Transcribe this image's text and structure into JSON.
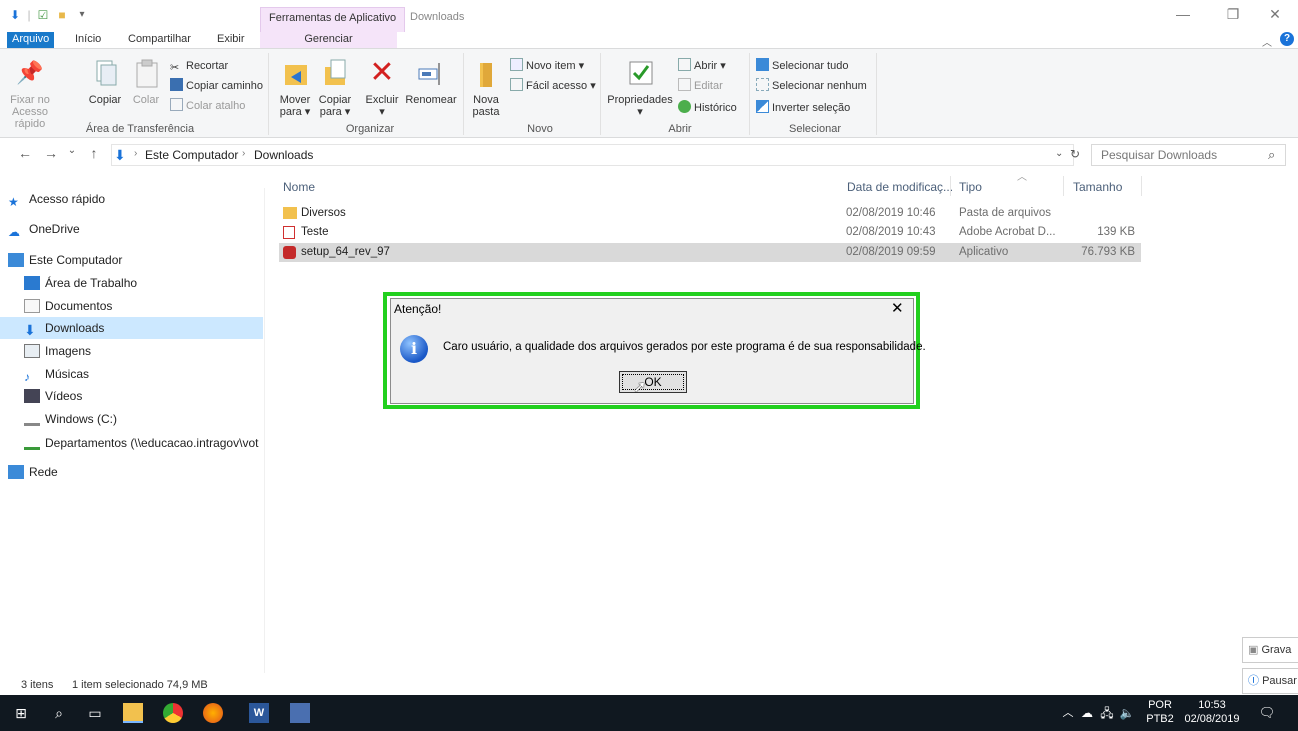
{
  "titlebar": {
    "tool_tab": "Ferramentas de Aplicativo",
    "window_title": "Downloads"
  },
  "ribbon_tabs": {
    "arquivo": "Arquivo",
    "inicio": "Início",
    "compartilhar": "Compartilhar",
    "exibir": "Exibir",
    "gerenciar": "Gerenciar"
  },
  "ribbon": {
    "fixar_1": "Fixar no",
    "fixar_2": "Acesso rápido",
    "copiar": "Copiar",
    "colar": "Colar",
    "recortar": "Recortar",
    "copiar_caminho": "Copiar caminho",
    "colar_atalho": "Colar atalho",
    "group_transferencia": "Área de Transferência",
    "mover_1": "Mover",
    "mover_2": "para ▾",
    "copiar_para_1": "Copiar",
    "copiar_para_2": "para ▾",
    "excluir_1": "Excluir",
    "excluir_2": "▾",
    "renomear": "Renomear",
    "group_organizar": "Organizar",
    "nova_pasta_1": "Nova",
    "nova_pasta_2": "pasta",
    "novo_item": "Novo item ▾",
    "facil_acesso": "Fácil acesso ▾",
    "group_novo": "Novo",
    "propriedades_1": "Propriedades",
    "propriedades_2": "▾",
    "abrir": "Abrir ▾",
    "editar": "Editar",
    "historico": "Histórico",
    "group_abrir": "Abrir",
    "selecionar_tudo": "Selecionar tudo",
    "selecionar_nenhum": "Selecionar nenhum",
    "inverter_selecao": "Inverter seleção",
    "group_selecionar": "Selecionar"
  },
  "address": {
    "crumb_1": "Este Computador",
    "crumb_2": "Downloads",
    "search_placeholder": "Pesquisar Downloads"
  },
  "sidebar": {
    "items": [
      "Acesso rápido",
      "OneDrive",
      "Este Computador",
      "Área de Trabalho",
      "Documentos",
      "Downloads",
      "Imagens",
      "Músicas",
      "Vídeos",
      "Windows (C:)",
      "Departamentos (\\\\educacao.intragov\\vot",
      "Rede"
    ]
  },
  "columns": {
    "nome": "Nome",
    "data": "Data de modificaç...",
    "tipo": "Tipo",
    "tamanho": "Tamanho"
  },
  "files": [
    {
      "name": "Diversos",
      "date": "02/08/2019 10:46",
      "type": "Pasta de arquivos",
      "size": ""
    },
    {
      "name": "Teste",
      "date": "02/08/2019 10:43",
      "type": "Adobe Acrobat D...",
      "size": "139 KB"
    },
    {
      "name": "setup_64_rev_97",
      "date": "02/08/2019 09:59",
      "type": "Aplicativo",
      "size": "76.793 KB"
    }
  ],
  "status": {
    "count": "3 itens",
    "selected": "1 item selecionado  74,9 MB"
  },
  "dialog": {
    "title": "Atenção!",
    "message": "Caro usuário, a qualidade dos arquivos gerados por este programa é de sua responsabilidade.",
    "ok": "OK",
    "highlight_color": "#22d01e"
  },
  "toasts": {
    "grava": "Grava",
    "pausar": "Pausar"
  },
  "tray": {
    "lang_1": "POR",
    "lang_2": "PTB2",
    "time": "10:53",
    "date": "02/08/2019"
  }
}
